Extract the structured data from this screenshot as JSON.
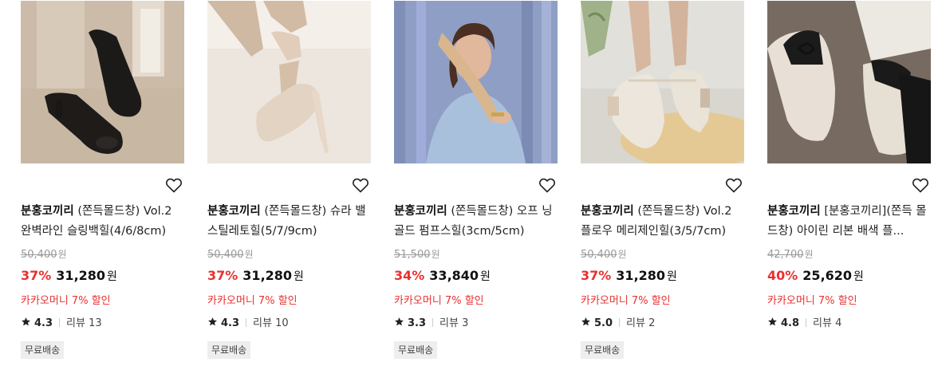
{
  "colors": {
    "discount": "#e8302f",
    "badge_bg": "#eeeeee",
    "strike": "#999999"
  },
  "icons": {
    "wish": "heart-outline-icon",
    "rating": "star-icon"
  },
  "products": [
    {
      "brand": "분홍코끼리",
      "name": "(쫀득몰드창) Vol.2 완벽라인 슬링백힐(4/6/8cm)",
      "original_price": "50,400",
      "original_unit": "원",
      "discount": "37%",
      "sale_price": "31,280",
      "sale_unit": "원",
      "promo": "카카오머니 7% 할인",
      "rating": "4.3",
      "reviews": "리뷰 13",
      "badge": "무료배송"
    },
    {
      "brand": "분홍코끼리",
      "name": "(쫀득몰드창) 슈라 밸 스틸레토힐(5/7/9cm)",
      "original_price": "50,400",
      "original_unit": "원",
      "discount": "37%",
      "sale_price": "31,280",
      "sale_unit": "원",
      "promo": "카카오머니 7% 할인",
      "rating": "4.3",
      "reviews": "리뷰 10",
      "badge": "무료배송"
    },
    {
      "brand": "분홍코끼리",
      "name": "(쫀득몰드창) 오프 닝 골드 펌프스힐(3cm/5cm)",
      "original_price": "51,500",
      "original_unit": "원",
      "discount": "34%",
      "sale_price": "33,840",
      "sale_unit": "원",
      "promo": "카카오머니 7% 할인",
      "rating": "3.3",
      "reviews": "리뷰 3",
      "badge": "무료배송"
    },
    {
      "brand": "분홍코끼리",
      "name": "(쫀득몰드창) Vol.2 플로우 메리제인힐(3/5/7cm)",
      "original_price": "50,400",
      "original_unit": "원",
      "discount": "37%",
      "sale_price": "31,280",
      "sale_unit": "원",
      "promo": "카카오머니 7% 할인",
      "rating": "5.0",
      "reviews": "리뷰 2",
      "badge": "무료배송"
    },
    {
      "brand": "분홍코끼리",
      "name": "[분홍코끼리](쫀득 몰드창) 아이린 리본 배색 플...",
      "original_price": "42,700",
      "original_unit": "원",
      "discount": "40%",
      "sale_price": "25,620",
      "sale_unit": "원",
      "promo": "카카오머니 7% 할인",
      "rating": "4.8",
      "reviews": "리뷰 4",
      "badge": ""
    }
  ]
}
